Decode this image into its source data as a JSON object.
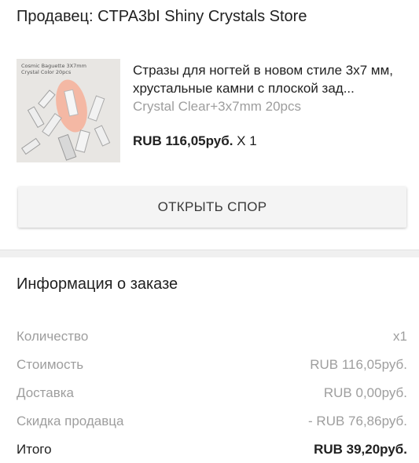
{
  "seller": {
    "label": "Продавец: CTPA3bI Shiny Crystals Store"
  },
  "product": {
    "image_caption_line1": "Cosmic Baguette 3X7mm",
    "image_caption_line2": "Crystal Color 20pcs",
    "title": "Стразы для ногтей в новом стиле 3x7 мм, хрустальные камни с плоской зад...",
    "variant": "Crystal Clear+3x7mm 20pcs",
    "price": "RUB 116,05руб.",
    "quantity": " X 1"
  },
  "actions": {
    "dispute_label": "ОТКРЫТЬ СПОР"
  },
  "order_info": {
    "title": "Информация о заказе",
    "rows": [
      {
        "label": "Количество",
        "value": "x1"
      },
      {
        "label": "Стоимость",
        "value": "RUB 116,05руб."
      },
      {
        "label": "Доставка",
        "value": "RUB 0,00руб."
      },
      {
        "label": "Скидка продавца",
        "value": "- RUB 76,86руб."
      },
      {
        "label": "Итого",
        "value": "RUB 39,20руб."
      }
    ]
  },
  "colors": {
    "primary_text": "#212121",
    "secondary_text": "#9e9e9e",
    "button_bg": "#f4f4f4"
  }
}
